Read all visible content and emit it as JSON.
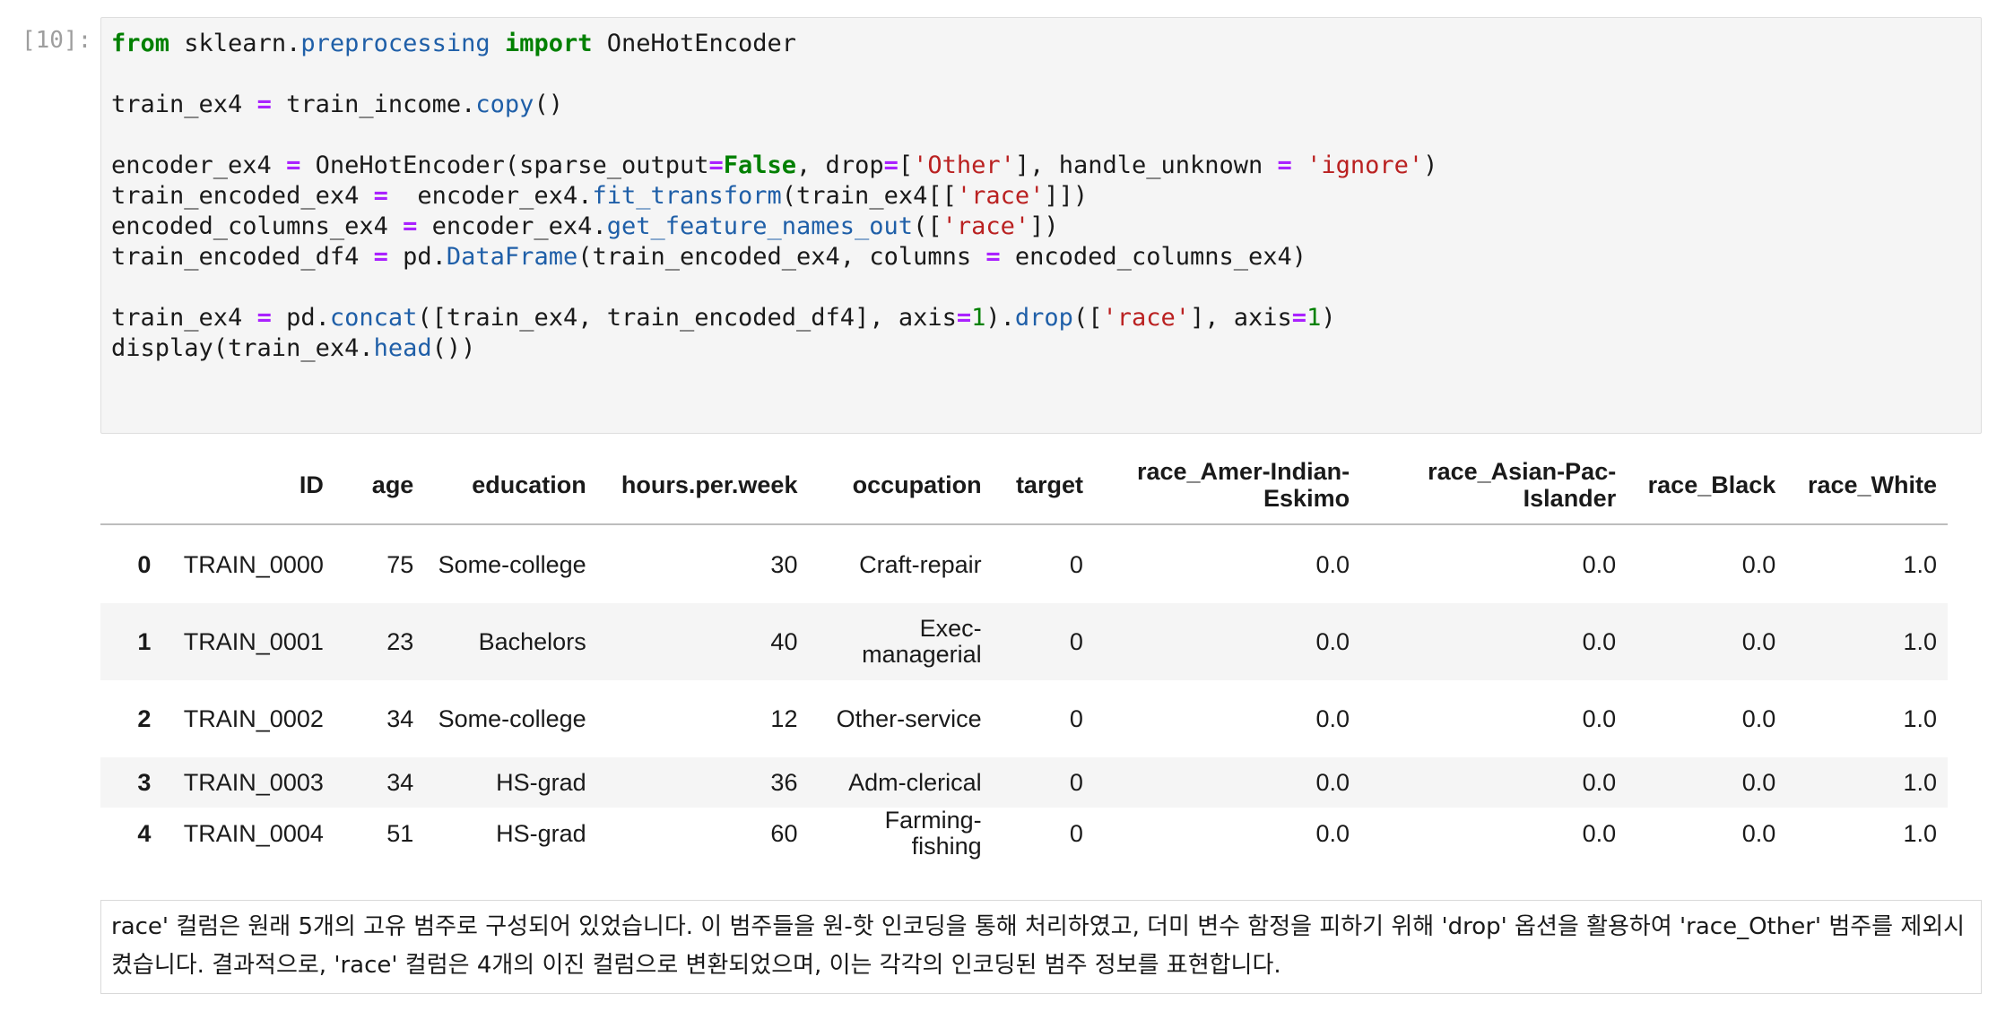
{
  "cell": {
    "prompt": "[10]:",
    "code_lines": [
      [
        [
          "kw",
          "from"
        ],
        [
          "t",
          " sklearn."
        ],
        [
          "fn",
          "preprocessing"
        ],
        [
          "t",
          " "
        ],
        [
          "kw",
          "import"
        ],
        [
          "t",
          " OneHotEncoder"
        ]
      ],
      [],
      [
        [
          "t",
          "train_ex4 "
        ],
        [
          "op",
          "="
        ],
        [
          "t",
          " train_income."
        ],
        [
          "fn",
          "copy"
        ],
        [
          "t",
          "()"
        ]
      ],
      [],
      [
        [
          "t",
          "encoder_ex4 "
        ],
        [
          "op",
          "="
        ],
        [
          "t",
          " OneHotEncoder(sparse_output"
        ],
        [
          "op",
          "="
        ],
        [
          "kw",
          "False"
        ],
        [
          "t",
          ", drop"
        ],
        [
          "op",
          "="
        ],
        [
          "t",
          "["
        ],
        [
          "str",
          "'Other'"
        ],
        [
          "t",
          "], handle_unknown "
        ],
        [
          "op",
          "="
        ],
        [
          "t",
          " "
        ],
        [
          "str",
          "'ignore'"
        ],
        [
          "t",
          ")"
        ]
      ],
      [
        [
          "t",
          "train_encoded_ex4 "
        ],
        [
          "op",
          "="
        ],
        [
          "t",
          "  encoder_ex4."
        ],
        [
          "fn",
          "fit_transform"
        ],
        [
          "t",
          "(train_ex4[["
        ],
        [
          "str",
          "'race'"
        ],
        [
          "t",
          "]])"
        ]
      ],
      [
        [
          "t",
          "encoded_columns_ex4 "
        ],
        [
          "op",
          "="
        ],
        [
          "t",
          " encoder_ex4."
        ],
        [
          "fn",
          "get_feature_names_out"
        ],
        [
          "t",
          "(["
        ],
        [
          "str",
          "'race'"
        ],
        [
          "t",
          "])"
        ]
      ],
      [
        [
          "t",
          "train_encoded_df4 "
        ],
        [
          "op",
          "="
        ],
        [
          "t",
          " pd."
        ],
        [
          "fn",
          "DataFrame"
        ],
        [
          "t",
          "(train_encoded_ex4, columns "
        ],
        [
          "op",
          "="
        ],
        [
          "t",
          " encoded_columns_ex4)"
        ]
      ],
      [],
      [
        [
          "t",
          "train_ex4 "
        ],
        [
          "op",
          "="
        ],
        [
          "t",
          " pd."
        ],
        [
          "fn",
          "concat"
        ],
        [
          "t",
          "([train_ex4, train_encoded_df4], axis"
        ],
        [
          "op",
          "="
        ],
        [
          "num",
          "1"
        ],
        [
          "t",
          ")."
        ],
        [
          "fn",
          "drop"
        ],
        [
          "t",
          "(["
        ],
        [
          "str",
          "'race'"
        ],
        [
          "t",
          "], axis"
        ],
        [
          "op",
          "="
        ],
        [
          "num",
          "1"
        ],
        [
          "t",
          ")"
        ]
      ],
      [
        [
          "t",
          "display(train_ex4."
        ],
        [
          "fn",
          "head"
        ],
        [
          "t",
          "())"
        ]
      ]
    ]
  },
  "table": {
    "columns": [
      "",
      "ID",
      "age",
      "education",
      "hours.per.week",
      "occupation",
      "target",
      "race_Amer-Indian-Eskimo",
      "race_Asian-Pac-Islander",
      "race_Black",
      "race_White"
    ],
    "rows": [
      [
        "0",
        "TRAIN_0000",
        "75",
        "Some-college",
        "30",
        "Craft-repair",
        "0",
        "0.0",
        "0.0",
        "0.0",
        "1.0"
      ],
      [
        "1",
        "TRAIN_0001",
        "23",
        "Bachelors",
        "40",
        "Exec-managerial",
        "0",
        "0.0",
        "0.0",
        "0.0",
        "1.0"
      ],
      [
        "2",
        "TRAIN_0002",
        "34",
        "Some-college",
        "12",
        "Other-service",
        "0",
        "0.0",
        "0.0",
        "0.0",
        "1.0"
      ],
      [
        "3",
        "TRAIN_0003",
        "34",
        "HS-grad",
        "36",
        "Adm-clerical",
        "0",
        "0.0",
        "0.0",
        "0.0",
        "1.0"
      ],
      [
        "4",
        "TRAIN_0004",
        "51",
        "HS-grad",
        "60",
        "Farming-fishing",
        "0",
        "0.0",
        "0.0",
        "0.0",
        "1.0"
      ]
    ]
  },
  "markdown": {
    "text": "race' 컬럼은 원래 5개의 고유 범주로 구성되어 있었습니다. 이 범주들을 원-핫 인코딩을 통해 처리하였고, 더미 변수 함정을 피하기 위해 'drop' 옵션을 활용하여 'race_Other' 범주를 제외시켰습니다. 결과적으로, 'race' 컬럼은 4개의 이진 컬럼으로 변환되었으며, 이는 각각의 인코딩된 범주 정보를 표현합니다."
  }
}
